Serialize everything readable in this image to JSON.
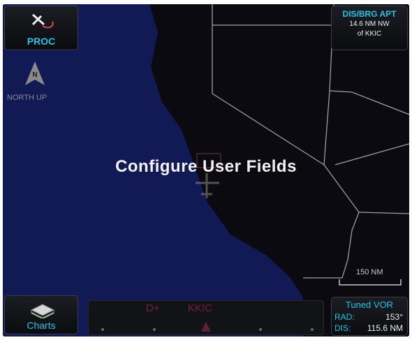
{
  "proc_button": {
    "label": "PROC",
    "icon": "procedure-icon"
  },
  "orientation": {
    "label": "NORTH UP",
    "arrow_letter": "N",
    "icon": "north-arrow-icon"
  },
  "user_field_top": {
    "title": "DIS/BRG APT",
    "line1": "14.6 NM NW",
    "line2": "of KKIC"
  },
  "overlay": {
    "text": "Configure User Fields"
  },
  "charts_button": {
    "label": "Charts",
    "icon": "charts-icon"
  },
  "waypoint_strip": {
    "waypoints": [
      "D+",
      "KKIC"
    ]
  },
  "user_field_bottom": {
    "title": "Tuned VOR",
    "rows": [
      {
        "key": "RAD:",
        "value": "153°"
      },
      {
        "key": "DIS:",
        "value": "115.6 NM"
      }
    ]
  },
  "map_scale": {
    "label": "150 NM"
  },
  "colors": {
    "accent": "#25c3e6",
    "water": "#121a55",
    "land": "#0a0a10",
    "boundary": "#9aa0a8"
  }
}
